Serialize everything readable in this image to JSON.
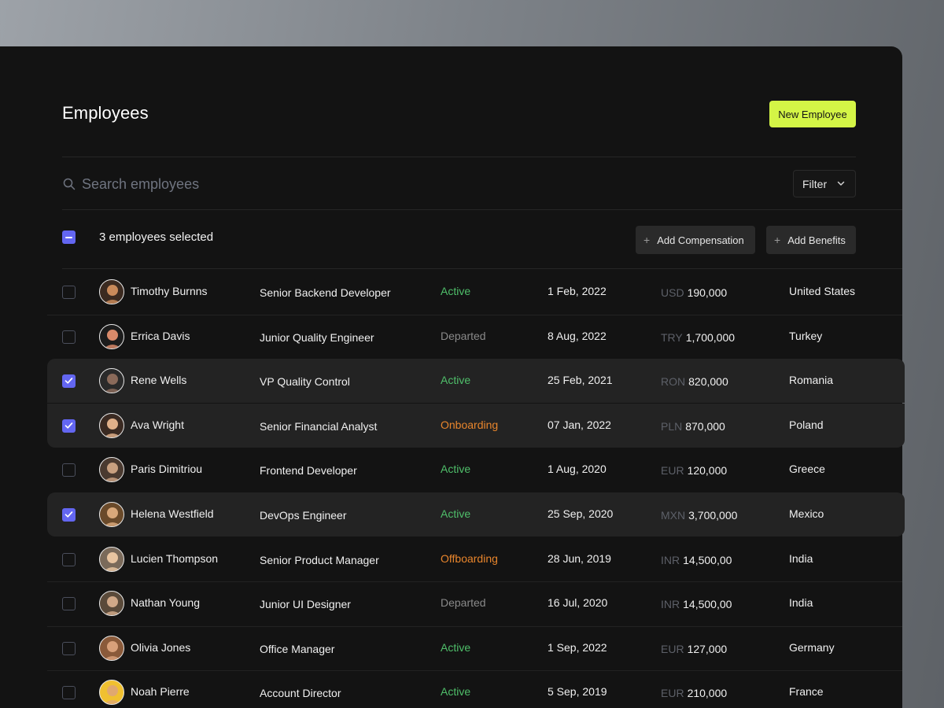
{
  "page": {
    "title": "Employees",
    "new_button": "New Employee",
    "search_placeholder": "Search employees",
    "filter_label": "Filter",
    "selected_text": "3 employees selected",
    "add_compensation": "Add Compensation",
    "add_benefits": "Add Benefits"
  },
  "colors": {
    "accent": "#d4f546",
    "checkbox": "#6366f1",
    "active": "#4fbf6a",
    "onboarding": "#e8852c",
    "departed": "#8a8a8a"
  },
  "employees": [
    {
      "name": "Timothy Burnns",
      "role": "Senior Backend Developer",
      "status": "Active",
      "date": "1 Feb, 2022",
      "currency": "USD",
      "amount": "190,000",
      "country": "United States",
      "selected": false
    },
    {
      "name": "Errica Davis",
      "role": "Junior Quality Engineer",
      "status": "Departed",
      "date": "8 Aug, 2022",
      "currency": "TRY",
      "amount": "1,700,000",
      "country": "Turkey",
      "selected": false
    },
    {
      "name": "Rene Wells",
      "role": "VP Quality Control",
      "status": "Active",
      "date": "25 Feb, 2021",
      "currency": "RON",
      "amount": "820,000",
      "country": "Romania",
      "selected": true
    },
    {
      "name": "Ava Wright",
      "role": "Senior Financial Analyst",
      "status": "Onboarding",
      "date": "07 Jan, 2022",
      "currency": "PLN",
      "amount": "870,000",
      "country": "Poland",
      "selected": true
    },
    {
      "name": "Paris Dimitriou",
      "role": "Frontend Developer",
      "status": "Active",
      "date": "1 Aug, 2020",
      "currency": "EUR",
      "amount": "120,000",
      "country": "Greece",
      "selected": false
    },
    {
      "name": "Helena Westfield",
      "role": "DevOps Engineer",
      "status": "Active",
      "date": "25 Sep, 2020",
      "currency": "MXN",
      "amount": "3,700,000",
      "country": "Mexico",
      "selected": true
    },
    {
      "name": "Lucien Thompson",
      "role": "Senior Product Manager",
      "status": "Offboarding",
      "date": "28 Jun, 2019",
      "currency": "INR",
      "amount": "14,500,00",
      "country": "India",
      "selected": false
    },
    {
      "name": "Nathan Young",
      "role": "Junior UI Designer",
      "status": "Departed",
      "date": "16 Jul, 2020",
      "currency": "INR",
      "amount": "14,500,00",
      "country": "India",
      "selected": false
    },
    {
      "name": "Olivia Jones",
      "role": "Office Manager",
      "status": "Active",
      "date": "1 Sep, 2022",
      "currency": "EUR",
      "amount": "127,000",
      "country": "Germany",
      "selected": false
    },
    {
      "name": "Noah Pierre",
      "role": "Account Director",
      "status": "Active",
      "date": "5 Sep, 2019",
      "currency": "EUR",
      "amount": "210,000",
      "country": "France",
      "selected": false
    }
  ]
}
